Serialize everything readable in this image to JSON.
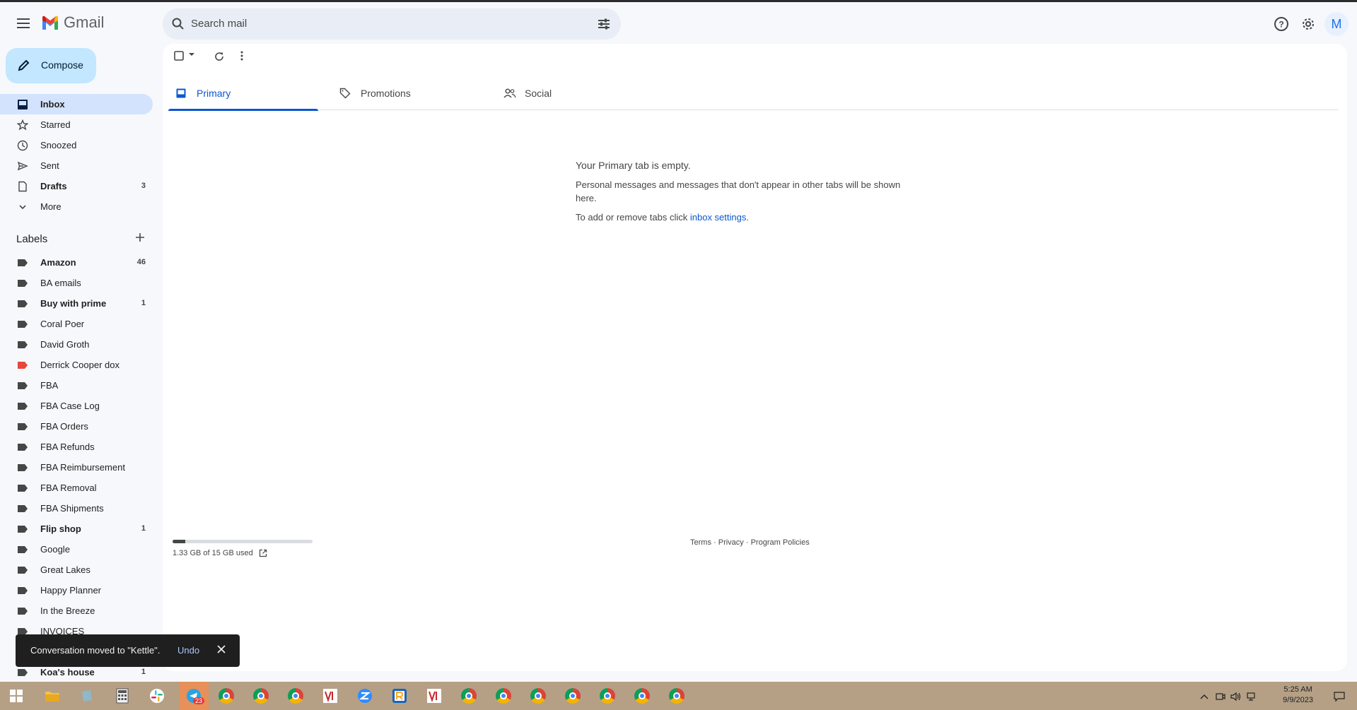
{
  "app": {
    "name": "Gmail"
  },
  "search": {
    "placeholder": "Search mail"
  },
  "header": {
    "avatar_letter": "M"
  },
  "compose": {
    "label": "Compose"
  },
  "nav": [
    {
      "label": "Inbox",
      "count": "",
      "icon": "inbox-icon",
      "active": true,
      "bold": true
    },
    {
      "label": "Starred",
      "count": "",
      "icon": "star-icon"
    },
    {
      "label": "Snoozed",
      "count": "",
      "icon": "clock-icon"
    },
    {
      "label": "Sent",
      "count": "",
      "icon": "send-icon"
    },
    {
      "label": "Drafts",
      "count": "3",
      "icon": "draft-icon",
      "bold": true
    },
    {
      "label": "More",
      "count": "",
      "icon": "chevron-down-icon"
    }
  ],
  "labels": {
    "title": "Labels",
    "items": [
      {
        "label": "Amazon",
        "count": "46",
        "bold": true,
        "color": "#444746"
      },
      {
        "label": "BA emails",
        "count": "",
        "color": "#444746"
      },
      {
        "label": "Buy with prime",
        "count": "1",
        "bold": true,
        "color": "#444746"
      },
      {
        "label": "Coral Poer",
        "count": "",
        "color": "#444746"
      },
      {
        "label": "David Groth",
        "count": "",
        "color": "#444746"
      },
      {
        "label": "Derrick Cooper dox",
        "count": "",
        "color": "#e8453c"
      },
      {
        "label": "FBA",
        "count": "",
        "color": "#444746"
      },
      {
        "label": "FBA Case Log",
        "count": "",
        "color": "#444746"
      },
      {
        "label": "FBA Orders",
        "count": "",
        "color": "#444746"
      },
      {
        "label": "FBA Refunds",
        "count": "",
        "color": "#444746"
      },
      {
        "label": "FBA Reimbursement",
        "count": "",
        "color": "#444746"
      },
      {
        "label": "FBA Removal",
        "count": "",
        "color": "#444746"
      },
      {
        "label": "FBA Shipments",
        "count": "",
        "color": "#444746"
      },
      {
        "label": "Flip shop",
        "count": "1",
        "bold": true,
        "color": "#444746"
      },
      {
        "label": "Google",
        "count": "",
        "color": "#444746"
      },
      {
        "label": "Great Lakes",
        "count": "",
        "color": "#444746"
      },
      {
        "label": "Happy Planner",
        "count": "",
        "color": "#444746"
      },
      {
        "label": "In the Breeze",
        "count": "",
        "color": "#444746"
      },
      {
        "label": "INVOICES",
        "count": "",
        "color": "#444746"
      },
      {
        "label": "",
        "count": "",
        "color": "#444746"
      },
      {
        "label": "Koa's house",
        "count": "1",
        "bold": true,
        "color": "#444746"
      }
    ]
  },
  "tabs": [
    {
      "label": "Primary",
      "icon": "inbox-icon",
      "active": true
    },
    {
      "label": "Promotions",
      "icon": "tag-icon"
    },
    {
      "label": "Social",
      "icon": "people-icon"
    }
  ],
  "empty_state": {
    "title": "Your Primary tab is empty.",
    "body": "Personal messages and messages that don't appear in other tabs will be shown here.",
    "settings_prefix": "To add or remove tabs click ",
    "settings_link": "inbox settings",
    "settings_suffix": "."
  },
  "storage": {
    "text": "1.33 GB of 15 GB used",
    "used_fraction": 0.089
  },
  "footer": {
    "terms": "Terms",
    "sep1": " · ",
    "privacy": "Privacy",
    "sep2": " · ",
    "policies": "Program Policies"
  },
  "snackbar": {
    "message": "Conversation moved to \"Kettle\".",
    "undo": "Undo"
  },
  "taskbar": {
    "badge": "23",
    "time": "5:25 AM",
    "date": "9/9/2023"
  },
  "colors": {
    "accent": "#0b57d0",
    "compose_bg": "#c2e7ff",
    "active_nav": "#d3e3fd",
    "taskbar": "#b5a086"
  }
}
